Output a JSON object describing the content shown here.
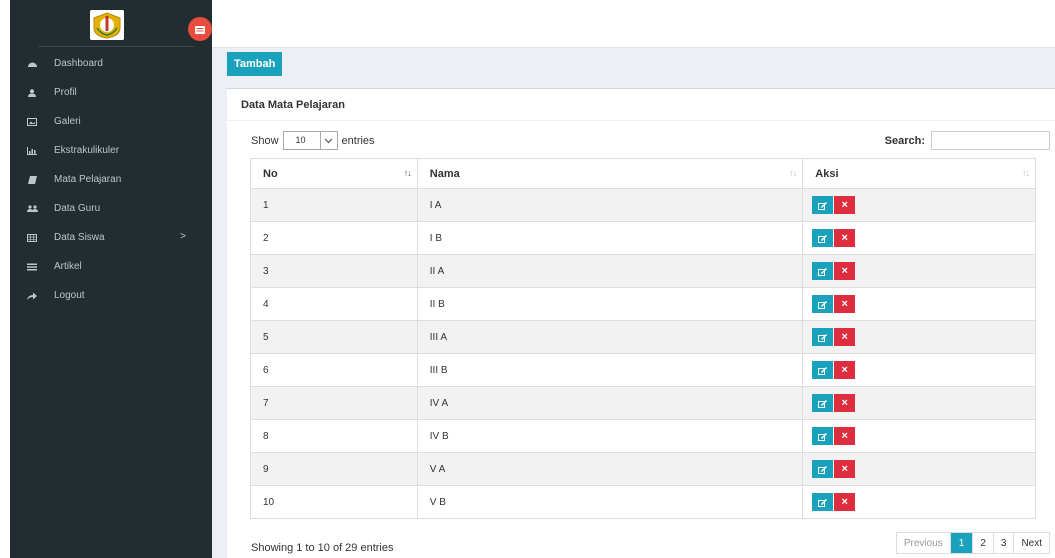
{
  "sidebar": {
    "items": [
      {
        "label": "Dashboard",
        "icon": "dashboard-icon"
      },
      {
        "label": "Profil",
        "icon": "user-icon"
      },
      {
        "label": "Galeri",
        "icon": "image-icon"
      },
      {
        "label": "Ekstrakulikuler",
        "icon": "bar-chart-icon"
      },
      {
        "label": "Mata Pelajaran",
        "icon": "book-icon"
      },
      {
        "label": "Data Guru",
        "icon": "users-icon"
      },
      {
        "label": "Data Siswa",
        "icon": "table-icon",
        "chevron": ">"
      },
      {
        "label": "Artikel",
        "icon": "list-icon"
      },
      {
        "label": "Logout",
        "icon": "share-icon"
      }
    ]
  },
  "content": {
    "add_button": "Tambah",
    "box_title": "Data Mata Pelajaran",
    "length": {
      "prefix": "Show",
      "value": "10",
      "suffix": "entries"
    },
    "search_label": "Search:",
    "search_value": "",
    "columns": [
      "No",
      "Nama",
      "Aksi"
    ],
    "rows": [
      {
        "no": "1",
        "nama": "I A"
      },
      {
        "no": "2",
        "nama": "I B"
      },
      {
        "no": "3",
        "nama": "II A"
      },
      {
        "no": "4",
        "nama": "II B"
      },
      {
        "no": "5",
        "nama": "III A"
      },
      {
        "no": "6",
        "nama": "III B"
      },
      {
        "no": "7",
        "nama": "IV A"
      },
      {
        "no": "8",
        "nama": "IV B"
      },
      {
        "no": "9",
        "nama": "V A"
      },
      {
        "no": "10",
        "nama": "V B"
      }
    ],
    "delete_glyph": "×",
    "info": "Showing 1 to 10 of 29 entries",
    "pagination": {
      "previous": "Previous",
      "pages": [
        "1",
        "2",
        "3"
      ],
      "active_page": "1",
      "next": "Next"
    }
  },
  "colors": {
    "sidebar_bg": "#222d32",
    "accent": "#1aa2bd",
    "danger": "#dd2d3f",
    "toggle": "#e74c3c"
  }
}
